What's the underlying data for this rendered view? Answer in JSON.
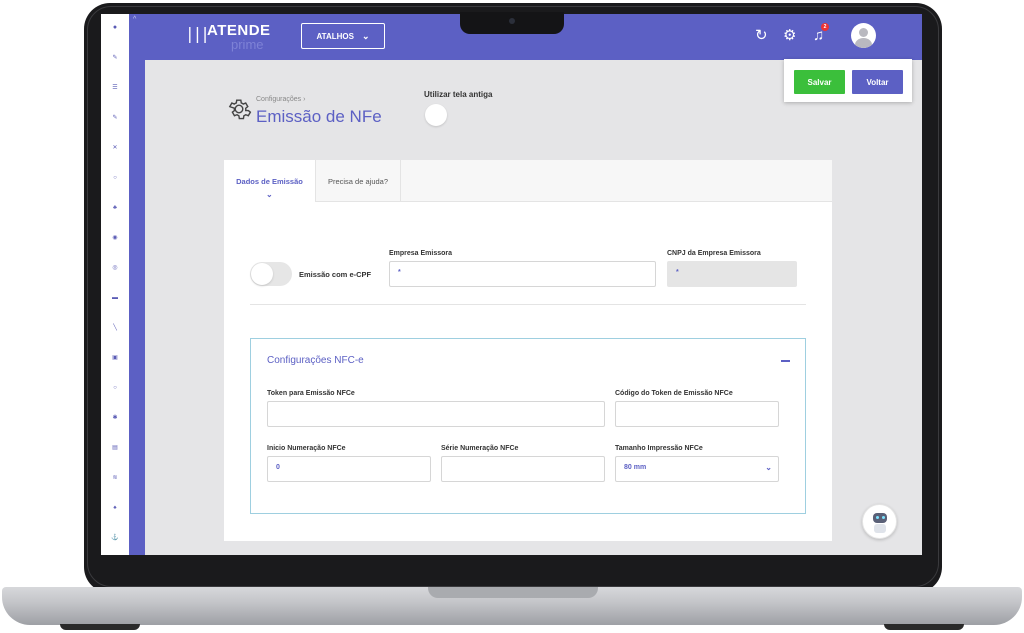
{
  "topbar": {
    "brand": "ATENDE",
    "brand_sub": "prime",
    "shortcuts_label": "ATALHOS",
    "notification_count": "2"
  },
  "actions": {
    "save_label": "Salvar",
    "back_label": "Voltar"
  },
  "page": {
    "breadcrumb": "Configurações",
    "title": "Emissão de NFe",
    "legacy_screen_label": "Utilizar tela antiga"
  },
  "tabs": [
    {
      "label": "Dados de Emissão",
      "active": true
    },
    {
      "label": "Precisa de ajuda?",
      "active": false
    }
  ],
  "form": {
    "ecpf_label": "Emissão com e-CPF",
    "empresa_label": "Empresa Emissora",
    "empresa_value": "*",
    "cnpj_label": "CNPJ da Empresa Emissora",
    "cnpj_value": "*"
  },
  "nfce": {
    "title": "Configurações NFC-e",
    "token_label": "Token para Emissão NFCe",
    "token_value": "",
    "token_code_label": "Código do Token de Emissão NFCe",
    "token_code_value": "",
    "start_number_label": "Inicio Numeração NFCe",
    "start_number_value": "0",
    "series_label": "Série Numeração NFCe",
    "series_value": "",
    "print_size_label": "Tamanho Impressão NFCe",
    "print_size_value": "80 mm"
  },
  "colors": {
    "primary": "#5c60c4",
    "save": "#3bbf3b",
    "panel_border": "#9ecfe0"
  }
}
